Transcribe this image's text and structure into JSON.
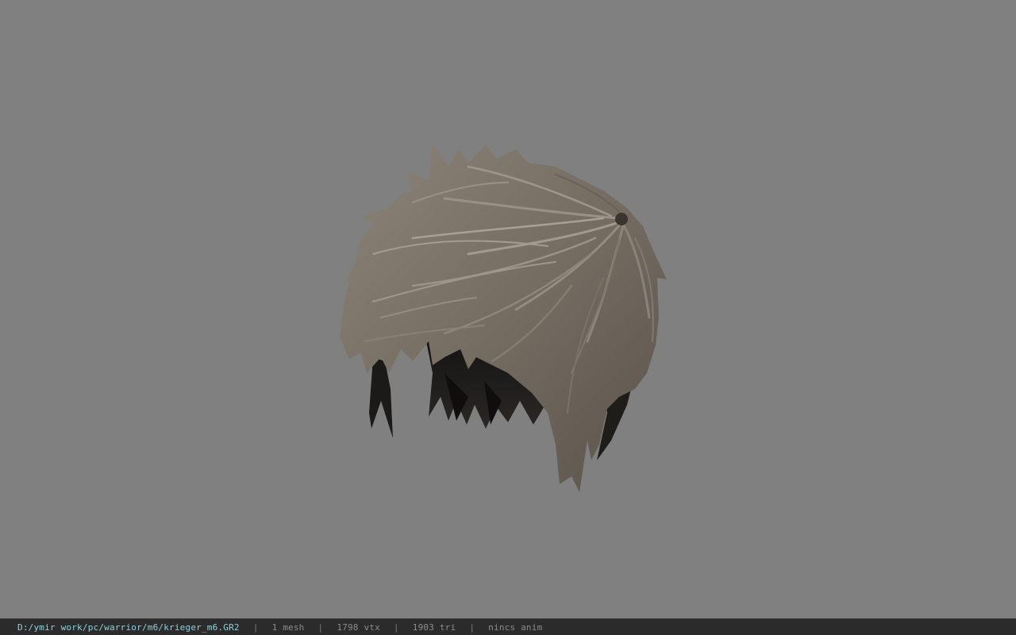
{
  "viewport": {
    "background_color": "#808080",
    "model": {
      "icon": "hair-mesh",
      "hair_color": "#7a7166",
      "underside_color": "#1e1c1a"
    }
  },
  "status_bar": {
    "file_path": "D:/ymir work/pc/warrior/m6/krieger_m6.GR2",
    "separator": "|",
    "mesh_count": "1 mesh",
    "vertex_count": "1798 vtx",
    "triangle_count": "1903 tri",
    "animation": "nincs anim",
    "path_color": "#8fd0dc",
    "text_color": "#8c8c8c"
  }
}
